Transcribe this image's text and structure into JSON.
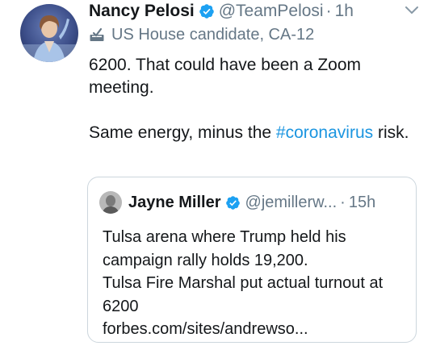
{
  "tweet": {
    "author": {
      "display_name": "Nancy Pelosi",
      "handle": "@TeamPelosi",
      "separator": "·",
      "time": "1h",
      "label": "US House candidate, CA-12",
      "avatar_icon": "profile-photo",
      "verified_icon": "verified-badge-icon"
    },
    "text": {
      "line1": "6200. That could have been a Zoom meeting.",
      "line2_prefix": "Same energy, minus the ",
      "hashtag": "#coronavirus",
      "line2_suffix": " risk."
    },
    "colors": {
      "text": "#14171a",
      "secondary": "#657786",
      "link": "#1b95e0",
      "verified": "#1da1f2",
      "border": "#ccd6dd"
    }
  },
  "quoted_tweet": {
    "display_name": "Jayne Miller",
    "handle": "@jemillerw...",
    "separator": "·",
    "time": "15h",
    "lines": [
      "Tulsa arena where Trump held his campaign rally holds 19,200.",
      "Tulsa Fire Marshal put actual turnout at 6200",
      "forbes.com/sites/andrewso..."
    ]
  }
}
